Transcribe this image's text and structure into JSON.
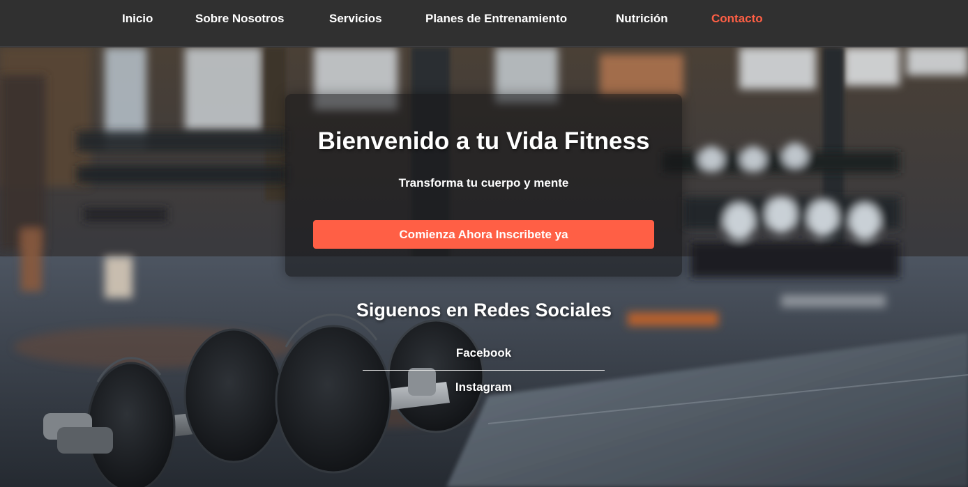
{
  "nav": {
    "items": [
      {
        "label": "Inicio",
        "active": false
      },
      {
        "label": "Sobre Nosotros",
        "active": false
      },
      {
        "label": "Servicios",
        "active": false
      },
      {
        "label": "Planes de Entrenamiento",
        "active": false
      },
      {
        "label": "Nutrición",
        "active": false
      },
      {
        "label": "Contacto",
        "active": true
      }
    ]
  },
  "hero": {
    "title": "Bienvenido a tu Vida Fitness",
    "subtitle": "Transforma tu cuerpo y mente",
    "cta_label": "Comienza Ahora Inscribete ya"
  },
  "social": {
    "title": "Siguenos en Redes Sociales",
    "links": [
      "Facebook",
      "Instagram"
    ]
  },
  "colors": {
    "accent": "#ff5f45",
    "nav_bg": "#303030",
    "text": "#ffffff"
  }
}
